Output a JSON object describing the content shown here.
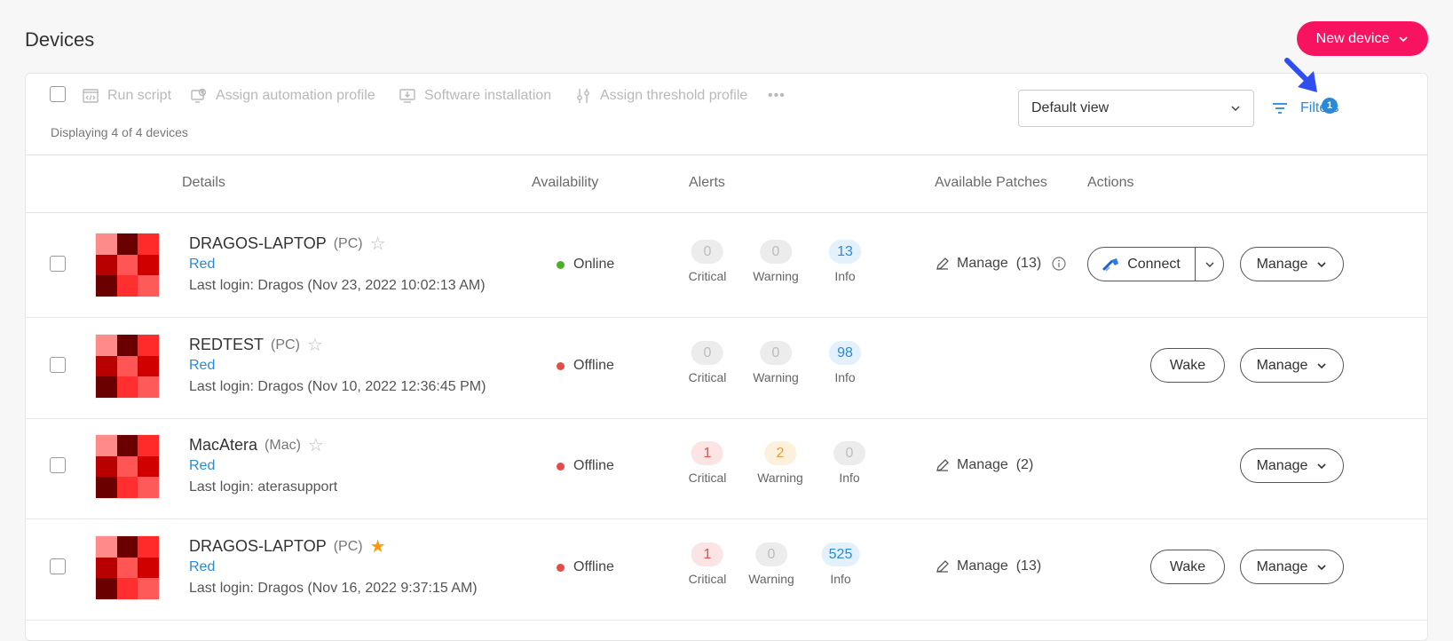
{
  "page": {
    "title": "Devices",
    "new_device_label": "New device"
  },
  "toolbar": {
    "run_script": "Run script",
    "assign_automation": "Assign automation profile",
    "software_installation": "Software installation",
    "assign_threshold": "Assign threshold profile",
    "more": "•••",
    "displaying": "Displaying 4 of 4 devices",
    "view_selected": "Default view",
    "filters_label": "Filters",
    "filters_count": "1"
  },
  "columns": {
    "details": "Details",
    "availability": "Availability",
    "alerts": "Alerts",
    "patches": "Available Patches",
    "actions": "Actions"
  },
  "alert_labels": {
    "critical": "Critical",
    "warning": "Warning",
    "info": "Info"
  },
  "colors": {
    "accent": "#f7135f",
    "link": "#2b8ad8",
    "online": "#4caf27",
    "offline": "#e84a4a",
    "thumb": [
      "#ff8a8a",
      "#6a0000",
      "#ff2a2a",
      "#b80000",
      "#ff5555",
      "#d00000",
      "#6a0000",
      "#ff2f2f",
      "#ff5a5a"
    ]
  },
  "devices": [
    {
      "name": "DRAGOS-LAPTOP",
      "type": "(PC)",
      "starred": false,
      "customer": "Red",
      "last_login": "Last login: Dragos (Nov 23, 2022 10:02:13 AM)",
      "status": "Online",
      "critical": "0",
      "warning": "0",
      "info": "13",
      "patches": "Manage  (13)",
      "connect_label": "Connect",
      "wake_label": "",
      "manage_label": "Manage"
    },
    {
      "name": "REDTEST",
      "type": "(PC)",
      "starred": false,
      "customer": "Red",
      "last_login": "Last login: Dragos (Nov 10, 2022 12:36:45 PM)",
      "status": "Offline",
      "critical": "0",
      "warning": "0",
      "info": "98",
      "patches": "",
      "connect_label": "",
      "wake_label": "Wake",
      "manage_label": "Manage"
    },
    {
      "name": "MacAtera",
      "type": "(Mac)",
      "starred": false,
      "customer": "Red",
      "last_login": "Last login: aterasupport",
      "status": "Offline",
      "critical": "1",
      "warning": "2",
      "info": "0",
      "patches": "Manage  (2)",
      "connect_label": "",
      "wake_label": "",
      "manage_label": "Manage"
    },
    {
      "name": "DRAGOS-LAPTOP",
      "type": "(PC)",
      "starred": true,
      "customer": "Red",
      "last_login": "Last login: Dragos (Nov 16, 2022 9:37:15 AM)",
      "status": "Offline",
      "critical": "1",
      "warning": "0",
      "info": "525",
      "patches": "Manage  (13)",
      "connect_label": "",
      "wake_label": "Wake",
      "manage_label": "Manage"
    }
  ]
}
